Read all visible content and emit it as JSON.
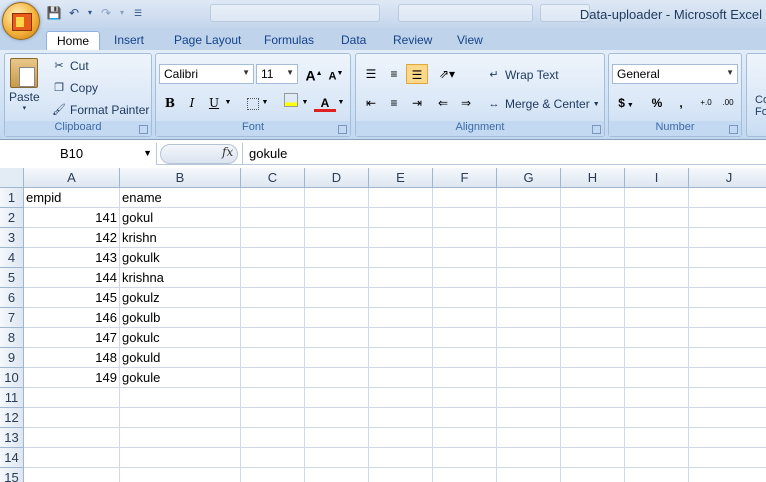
{
  "window": {
    "title": "Data-uploader - Microsoft Excel",
    "background_tabs": [
      "",
      "",
      ""
    ]
  },
  "tabs": [
    "Home",
    "Insert",
    "Page Layout",
    "Formulas",
    "Data",
    "Review",
    "View"
  ],
  "active_tab": "Home",
  "ribbon": {
    "clipboard": {
      "label": "Clipboard",
      "paste": "Paste",
      "cut": "Cut",
      "copy": "Copy",
      "format_painter": "Format Painter"
    },
    "font": {
      "label": "Font",
      "font_name": "Calibri",
      "font_size": "11",
      "bold": "B",
      "italic": "I",
      "underline": "U",
      "font_color_glyph": "A"
    },
    "alignment": {
      "label": "Alignment",
      "wrap_text": "Wrap Text",
      "merge_center": "Merge & Center"
    },
    "number": {
      "label": "Number",
      "format": "General",
      "currency": "$",
      "percent": "%",
      "comma": ",",
      "inc_decimal": "+.0",
      "dec_decimal": ".00"
    },
    "styles_partial": {
      "line1": "Co",
      "line2": "Fo"
    }
  },
  "formula_bar": {
    "name_box": "B10",
    "fx": "fx",
    "content": "gokule"
  },
  "columns": [
    "A",
    "B",
    "C",
    "D",
    "E",
    "F",
    "G",
    "H",
    "I",
    "J"
  ],
  "rows": [
    {
      "n": "1",
      "a": "empid",
      "b": "ename"
    },
    {
      "n": "2",
      "a": "141",
      "b": "gokul"
    },
    {
      "n": "3",
      "a": "142",
      "b": "krishn"
    },
    {
      "n": "4",
      "a": "143",
      "b": "gokulk"
    },
    {
      "n": "5",
      "a": "144",
      "b": "krishna"
    },
    {
      "n": "6",
      "a": "145",
      "b": "gokulz"
    },
    {
      "n": "7",
      "a": "146",
      "b": "gokulb"
    },
    {
      "n": "8",
      "a": "147",
      "b": "gokulc"
    },
    {
      "n": "9",
      "a": "148",
      "b": "gokuld"
    },
    {
      "n": "10",
      "a": "149",
      "b": "gokule"
    },
    {
      "n": "11",
      "a": "",
      "b": ""
    },
    {
      "n": "12",
      "a": "",
      "b": ""
    },
    {
      "n": "13",
      "a": "",
      "b": ""
    },
    {
      "n": "14",
      "a": "",
      "b": ""
    },
    {
      "n": "15",
      "a": "",
      "b": ""
    }
  ],
  "colors": {
    "ribbon_bg": "#cddff4",
    "tab_text": "#15428b",
    "grid_line": "#d0d7e5",
    "header_bg": "#dde6f1"
  }
}
